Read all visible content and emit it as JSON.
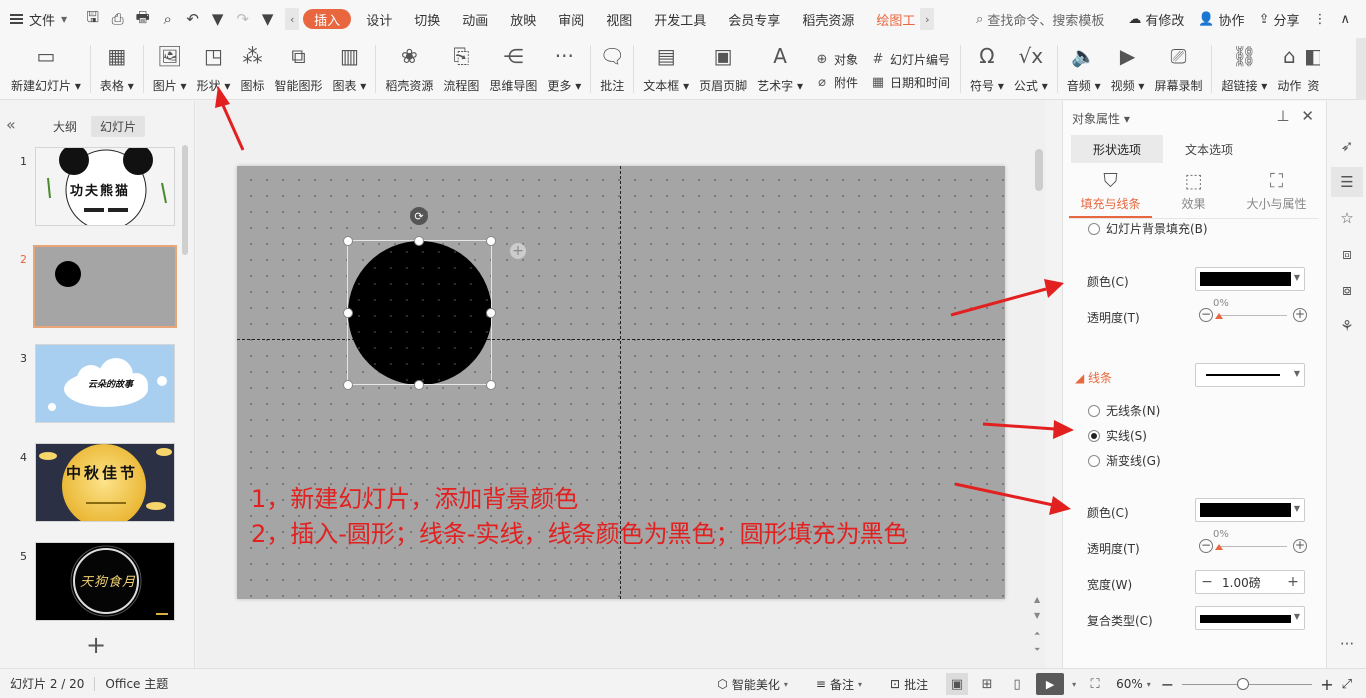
{
  "menubar": {
    "file_label": "文件",
    "tabs": [
      {
        "label": "插入",
        "active": true
      },
      {
        "label": "设计"
      },
      {
        "label": "切换"
      },
      {
        "label": "动画"
      },
      {
        "label": "放映"
      },
      {
        "label": "审阅"
      },
      {
        "label": "视图"
      },
      {
        "label": "开发工具"
      },
      {
        "label": "会员专享"
      },
      {
        "label": "稻壳资源"
      },
      {
        "label": "绘图工"
      }
    ],
    "search_placeholder": "查找命令、搜索模板",
    "right": {
      "modify": "有修改",
      "collab": "协作",
      "share": "分享"
    }
  },
  "ribbon": {
    "new_slide": "新建幻灯片",
    "table": "表格",
    "picture": "图片",
    "shape": "形状",
    "icon": "图标",
    "smartart": "智能图形",
    "chart": "图表",
    "docer": "稻壳资源",
    "flowchart": "流程图",
    "mindmap": "思维导图",
    "more": "更多",
    "comment": "批注",
    "textbox": "文本框",
    "header_footer": "页眉页脚",
    "wordart": "艺术字",
    "object": "对象",
    "attachment": "附件",
    "slide_number": "幻灯片编号",
    "datetime": "日期和时间",
    "symbol": "符号",
    "formula": "公式",
    "audio": "音频",
    "video": "视频",
    "screen_record": "屏幕录制",
    "hyperlink": "超链接",
    "action": "动作",
    "truncated": "资"
  },
  "left_panel": {
    "tab_outline": "大纲",
    "tab_slides": "幻灯片",
    "slides": [
      {
        "num": "1",
        "title": "功夫熊猫"
      },
      {
        "num": "2",
        "title": ""
      },
      {
        "num": "3",
        "title": "云朵的故事"
      },
      {
        "num": "4",
        "title": "中秋佳节"
      },
      {
        "num": "5",
        "title": "天狗食月"
      }
    ],
    "active_index": 1
  },
  "slide": {
    "background_color": "#a5a5a5",
    "circle_fill": "#000000",
    "annotation_line1": "1，新建幻灯片，添加背景颜色",
    "annotation_line2": "2，插入-圆形；线条-实线，线条颜色为黑色；圆形填充为黑色",
    "annotation_color": "#e32020"
  },
  "props": {
    "header": "对象属性",
    "tab_shape": "形状选项",
    "tab_text": "文本选项",
    "sub_fill_line": "填充与线条",
    "sub_effect": "效果",
    "sub_size": "大小与属性",
    "slide_bg_fill": "幻灯片背景填充(B)",
    "fill_color_label": "颜色(C)",
    "fill_transparency_label": "透明度(T)",
    "fill_transparency_value": "0%",
    "line_section": "线条",
    "no_line": "无线条(N)",
    "solid_line": "实线(S)",
    "gradient_line": "渐变线(G)",
    "line_color_label": "颜色(C)",
    "line_transparency_label": "透明度(T)",
    "line_transparency_value": "0%",
    "width_label": "宽度(W)",
    "width_value": "1.00磅",
    "compound_label": "复合类型(C)"
  },
  "statusbar": {
    "slide_info": "幻灯片 2 / 20",
    "theme": "Office 主题",
    "smart_beautify": "智能美化",
    "notes": "备注",
    "comment": "批注",
    "zoom": "60%"
  },
  "colors": {
    "accent": "#e8673f",
    "arrow": "#e32020"
  }
}
